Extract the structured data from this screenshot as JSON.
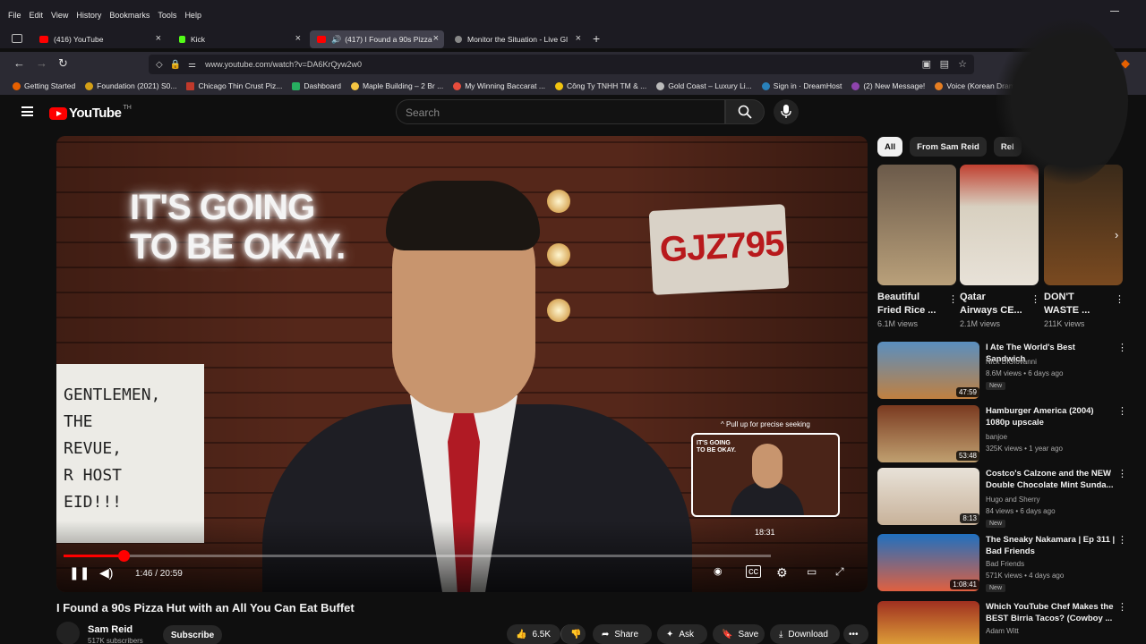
{
  "menubar": {
    "items": [
      "File",
      "Edit",
      "View",
      "History",
      "Bookmarks",
      "Tools",
      "Help"
    ]
  },
  "tabs": [
    {
      "label": "(416) YouTube",
      "color": "#ff0000"
    },
    {
      "label": "Kick",
      "color": "#53fc18"
    },
    {
      "label": "(417) I Found a 90s Pizza H",
      "color": "#ff0000"
    },
    {
      "label": "Monitor the Situation - Live Gl",
      "color": "#888888"
    }
  ],
  "url": "www.youtube.com/watch?v=DA6KrQyw2w0",
  "bookmarks": [
    {
      "label": "Getting Started",
      "color": "#e66000"
    },
    {
      "label": "Foundation (2021) S0...",
      "color": "#d4a017"
    },
    {
      "label": "Chicago Thin Crust Piz...",
      "color": "#c0392b"
    },
    {
      "label": "Dashboard",
      "color": "#27ae60"
    },
    {
      "label": "Maple Building – 2 Br ...",
      "color": "#f5c542"
    },
    {
      "label": "My Winning Baccarat ...",
      "color": "#e74c3c"
    },
    {
      "label": "Công Ty TNHH TM & ...",
      "color": "#f1c40f"
    },
    {
      "label": "Gold Coast – Luxury Li...",
      "color": "#bbbbbb"
    },
    {
      "label": "Sign in · DreamHost",
      "color": "#2980b9"
    },
    {
      "label": "(2) New Message!",
      "color": "#8e44ad"
    },
    {
      "label": "Voice (Korean Drama) ...",
      "color": "#e67e22"
    }
  ],
  "youtube": {
    "logo_text": "YouTube",
    "logo_suffix": "TH",
    "search_placeholder": "Search"
  },
  "video": {
    "neon_sign": "IT'S GOING\nTO BE OKAY.",
    "plate_text": "GJZ795",
    "board_text": "GENTLEMEN,\nTHE\nREVUE,\nR HOST\nEID!!!",
    "current_time": "1:46 / 20:59",
    "progress_fraction": 0.085,
    "hover_time": "18:31",
    "hover_fraction": 0.99,
    "seek_hint": "^ Pull up for precise seeking",
    "preview_sign": "IT'S GOING\nTO BE OKAY."
  },
  "meta": {
    "title": "I Found a 90s Pizza Hut with an All You Can Eat Buffet",
    "channel": "Sam Reid",
    "subscribers": "517K subscribers",
    "subscribe_label": "Subscribe",
    "likes": "6.5K",
    "share": "Share",
    "ask": "Ask",
    "save": "Save",
    "download": "Download",
    "more": "•••"
  },
  "chips": [
    "All",
    "From Sam Reid",
    "Rel"
  ],
  "shorts": [
    {
      "title": "Beautiful\nFried Rice ...",
      "views": "6.1M views",
      "color": "#b9a07a"
    },
    {
      "title": "Qatar\nAirways CE...",
      "views": "2.1M views",
      "color": "#d8d0c0"
    },
    {
      "title": "DON'T\nWASTE ...",
      "views": "211K views",
      "color": "#7a4a20"
    }
  ],
  "recommendations": [
    {
      "title": "I Ate The World's Best Sandwich",
      "channel": "Nick DiGiovanni",
      "meta": "8.6M views • 6 days ago",
      "badge": "New",
      "duration": "47:59",
      "color": "#5a8fc0"
    },
    {
      "title": "Hamburger America (2004) 1080p upscale",
      "channel": "banjoe",
      "meta": "325K views • 1 year ago",
      "badge": "",
      "duration": "53:48",
      "color": "#7a3a20"
    },
    {
      "title": "Costco's Calzone and the NEW Double Chocolate Mint Sunda...",
      "channel": "Hugo and Sherry",
      "meta": "84 views • 6 days ago",
      "badge": "New",
      "duration": "8:13",
      "color": "#c8b29a"
    },
    {
      "title": "The Sneaky Nakamara | Ep 311 | Bad Friends",
      "channel": "Bad Friends",
      "meta": "571K views • 4 days ago",
      "badge": "New",
      "duration": "1:08:41",
      "color": "#2070c0"
    },
    {
      "title": "Which YouTube Chef Makes the BEST Birria Tacos? (Cowboy ...",
      "channel": "Adam Witt",
      "meta": "",
      "badge": "",
      "duration": "",
      "color": "#a03020"
    }
  ]
}
